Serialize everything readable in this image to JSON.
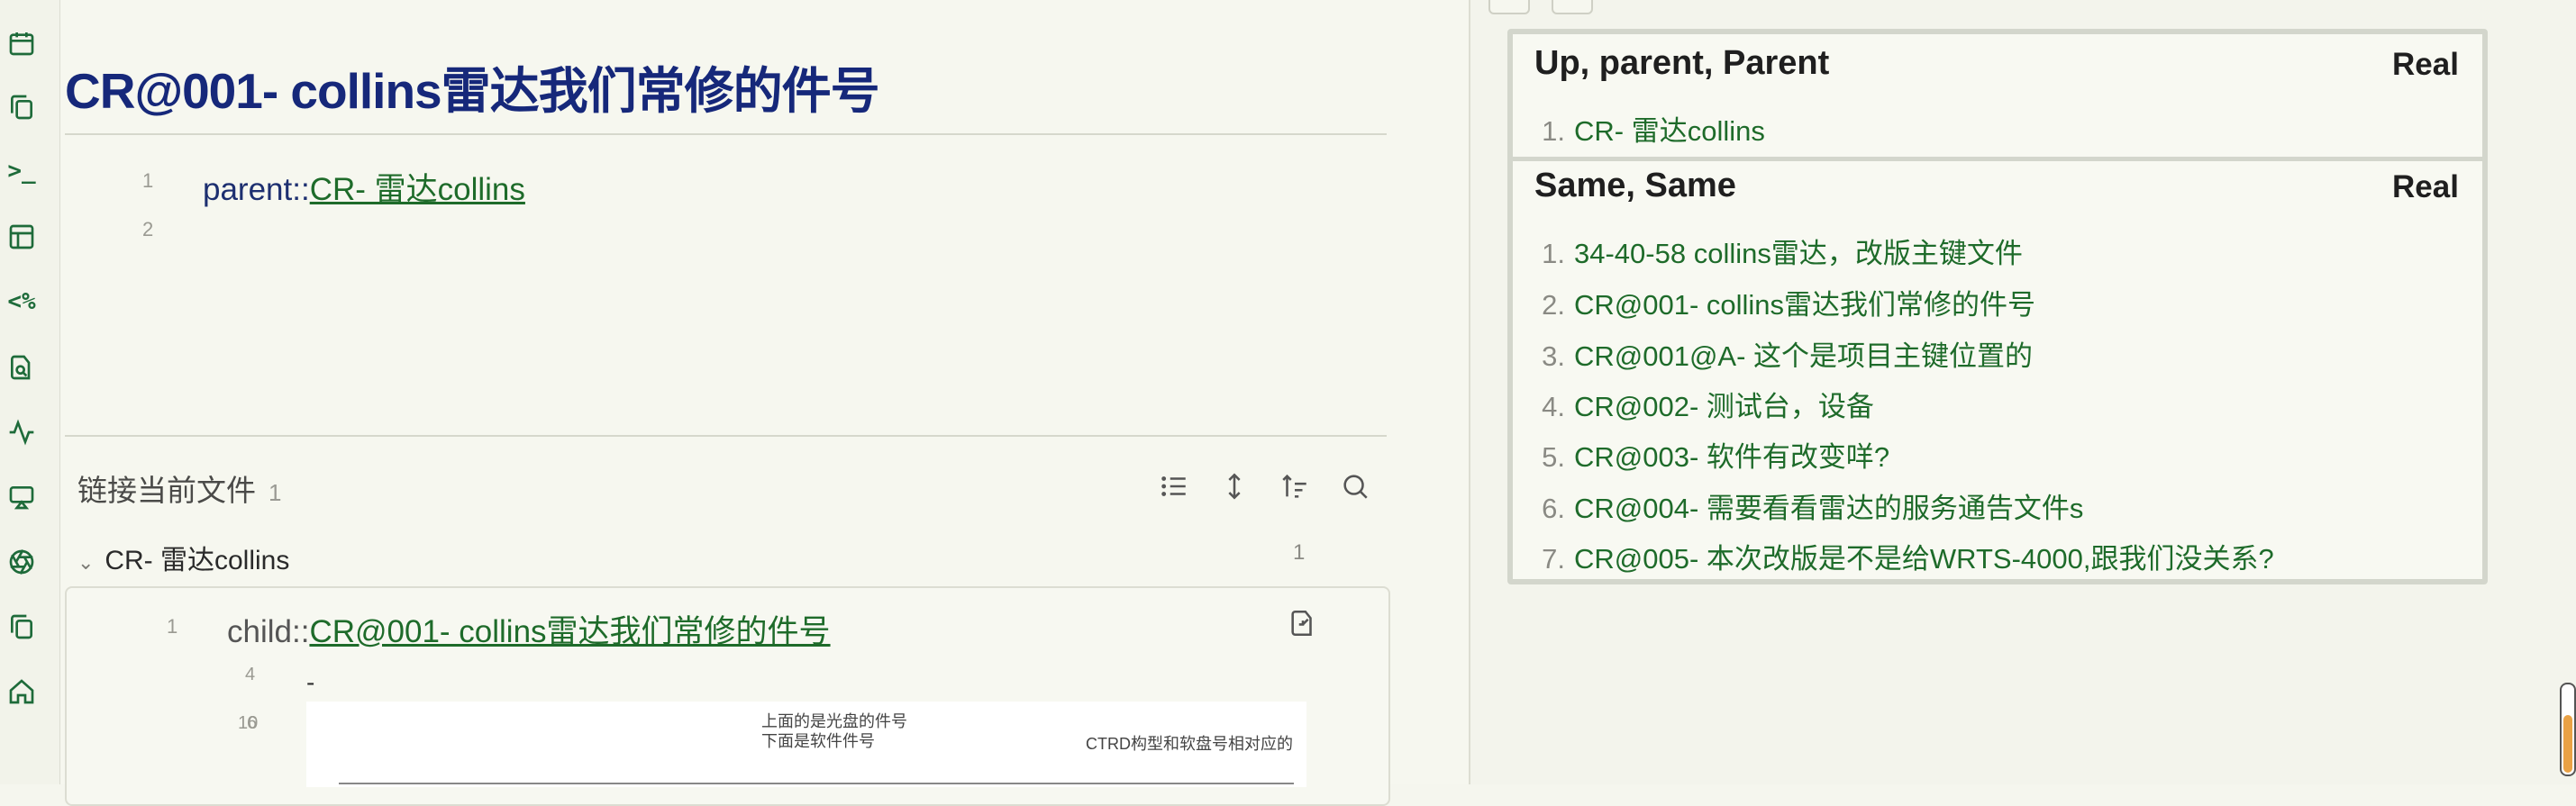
{
  "ribbon": {
    "icons": [
      "calendar-icon",
      "files-icon",
      "terminal-icon",
      "layout-icon",
      "templater-icon",
      "file-search-icon",
      "activity-icon",
      "presentation-icon",
      "aperture-icon",
      "copy-icon",
      "home-icon"
    ],
    "templater_glyph": "<%",
    "terminal_glyph": ">_"
  },
  "editor": {
    "title": "CR@001- collins雷达我们常修的件号",
    "lines": [
      {
        "num": "1",
        "prefix": "parent::",
        "link": "CR- 雷达collins"
      },
      {
        "num": "2"
      }
    ]
  },
  "backlinks": {
    "header": "链接当前文件",
    "count": "1",
    "group": {
      "name": "CR- 雷达collins",
      "count": "1"
    },
    "card": {
      "line_num": "1",
      "prefix": "child::",
      "link": "CR@001- collins雷达我们常修的件号",
      "sub_nums": [
        "4",
        "10",
        "6"
      ],
      "dash": "-",
      "snippet_lines": [
        "上面的是光盘的件号",
        "下面是软件件号"
      ],
      "snippet_right": "CTRD构型和软盘号相对应的"
    }
  },
  "right_panel": {
    "section1": {
      "title": "Up, parent, Parent",
      "real": "Real",
      "items": [
        {
          "n": "1.",
          "t": "CR- 雷达collins"
        }
      ]
    },
    "section2": {
      "title": "Same, Same",
      "real": "Real",
      "items": [
        {
          "n": "1.",
          "t": "34-40-58 collins雷达，改版主键文件"
        },
        {
          "n": "2.",
          "t": "CR@001- collins雷达我们常修的件号"
        },
        {
          "n": "3.",
          "t": "CR@001@A- 这个是项目主键位置的"
        },
        {
          "n": "4.",
          "t": "CR@002- 测试台，设备"
        },
        {
          "n": "5.",
          "t": "CR@003- 软件有改变咩?"
        },
        {
          "n": "6.",
          "t": "CR@004- 需要看看雷达的服务通告文件s"
        },
        {
          "n": "7.",
          "t": "CR@005- 本次改版是不是给WRTS-4000,跟我们没关系?"
        }
      ]
    }
  },
  "colors": {
    "title": "#16287a",
    "link": "#1e6b2a",
    "accent": "#e9a145"
  }
}
